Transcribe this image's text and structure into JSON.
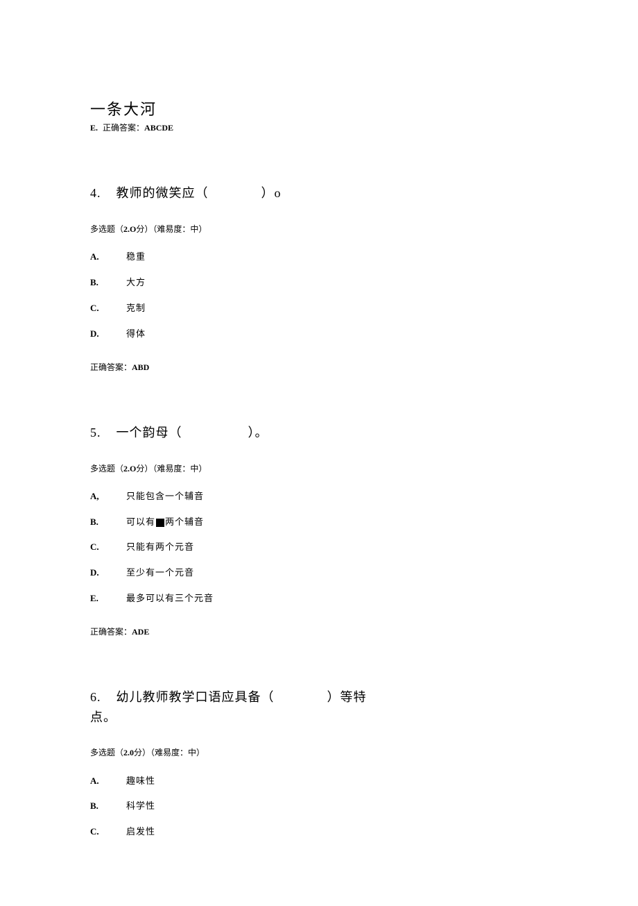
{
  "prev": {
    "title": "一条大河",
    "option_e_letter": "E.",
    "correct_label": "正确答案：",
    "correct_answer": "ABCDE"
  },
  "q4": {
    "number": "4.",
    "stem": "教师的微笑应（　　　　）o",
    "meta_prefix": "多选题（",
    "meta_points": "2.O",
    "meta_mid": "分）（难易度：中）",
    "options": [
      {
        "letter": "A.",
        "text": "稳重"
      },
      {
        "letter": "B.",
        "text": "大方"
      },
      {
        "letter": "C.",
        "text": "克制"
      },
      {
        "letter": "D.",
        "text": "得体"
      }
    ],
    "correct_label": "正确答案：",
    "correct_answer": "ABD"
  },
  "q5": {
    "number": "5.",
    "stem": "一个韵母（　　　　　）。",
    "meta_prefix": "多选题（",
    "meta_points": "2.O",
    "meta_mid": "分）（难易度：中）",
    "options": [
      {
        "letter": "A,",
        "text": "只能包含一个辅音"
      },
      {
        "letter": "B.",
        "text": "可以有",
        "square": true,
        "text2": "两个辅音"
      },
      {
        "letter": "C.",
        "text": "只能有两个元音"
      },
      {
        "letter": "D.",
        "text": "至少有一个元音"
      },
      {
        "letter": "E.",
        "text": "最多可以有三个元音"
      }
    ],
    "correct_label": "正确答案：",
    "correct_answer": "ADE"
  },
  "q6": {
    "number": "6.",
    "stem": "幼儿教师教学口语应具备（　　　　）等特点。",
    "meta_prefix": "多选题（",
    "meta_points": "2.0",
    "meta_mid": "分）（难易度：中）",
    "options": [
      {
        "letter": "A.",
        "text": "趣味性"
      },
      {
        "letter": "B.",
        "text": "科学性"
      },
      {
        "letter": "C.",
        "text": "启发性"
      }
    ]
  }
}
